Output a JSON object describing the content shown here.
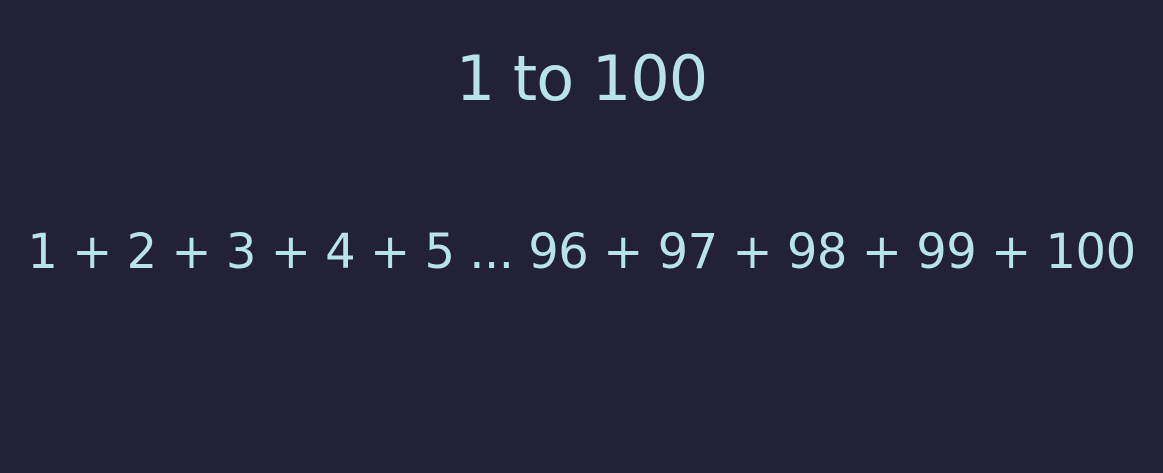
{
  "slide": {
    "title": "1 to 100",
    "expression": "1 + 2 + 3 + 4 + 5 ...  96 + 97 + 98 + 99 + 100"
  },
  "colors": {
    "background": "#23213a",
    "text": "#b7e3ea"
  }
}
